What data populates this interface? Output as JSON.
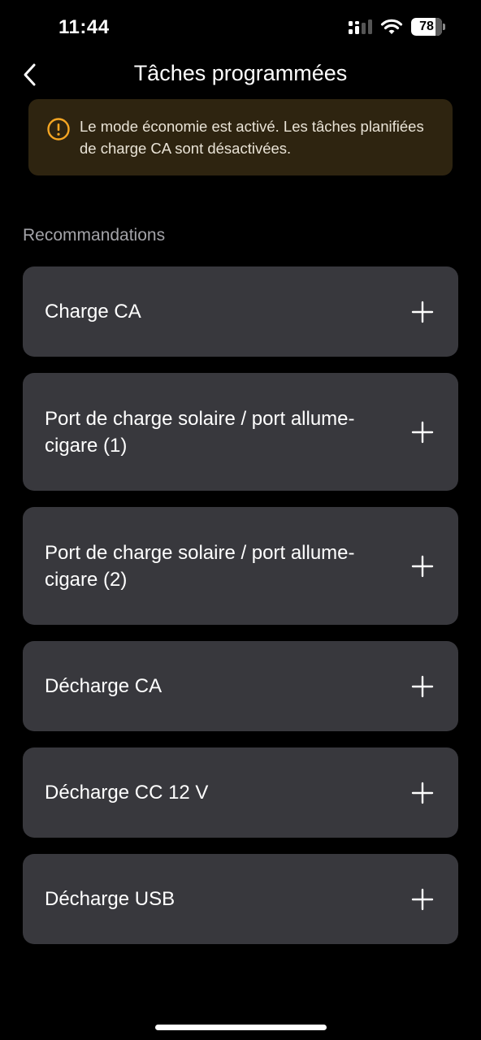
{
  "status_bar": {
    "time": "11:44",
    "battery_level": "78",
    "battery_fraction": 0.78
  },
  "header": {
    "title": "Tâches programmées"
  },
  "banner": {
    "text": "Le mode économie est activé. Les tâches planifiées de charge CA sont désactivées.",
    "accent_color": "#f5a623"
  },
  "section": {
    "label": "Recommandations"
  },
  "items": [
    {
      "label": "Charge CA"
    },
    {
      "label": "Port de charge solaire / port allume-cigare (1)"
    },
    {
      "label": "Port de charge solaire / port allume-cigare (2)"
    },
    {
      "label": "Décharge CA"
    },
    {
      "label": "Décharge CC 12 V"
    },
    {
      "label": "Décharge USB"
    }
  ]
}
